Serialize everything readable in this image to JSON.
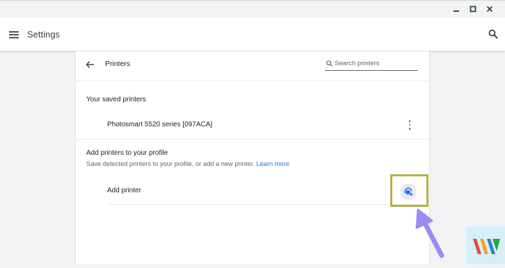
{
  "app": {
    "title": "Settings"
  },
  "window_controls": [
    "minimize",
    "maximize",
    "close"
  ],
  "printers_page": {
    "title": "Printers",
    "search_placeholder": "Search printers",
    "saved_heading": "Your saved printers",
    "saved_printers": [
      {
        "name": "Photosmart 5520 series [097ACA]"
      }
    ],
    "add_heading": "Add printers to your profile",
    "add_description": "Save detected printers to your profile, or add a new printer.",
    "learn_more": "Learn more",
    "add_printer_label": "Add printer"
  },
  "colors": {
    "accent": "#1a73e8",
    "highlight_box": "#b5b14a",
    "pointer_arrow": "#9a8cf2"
  }
}
